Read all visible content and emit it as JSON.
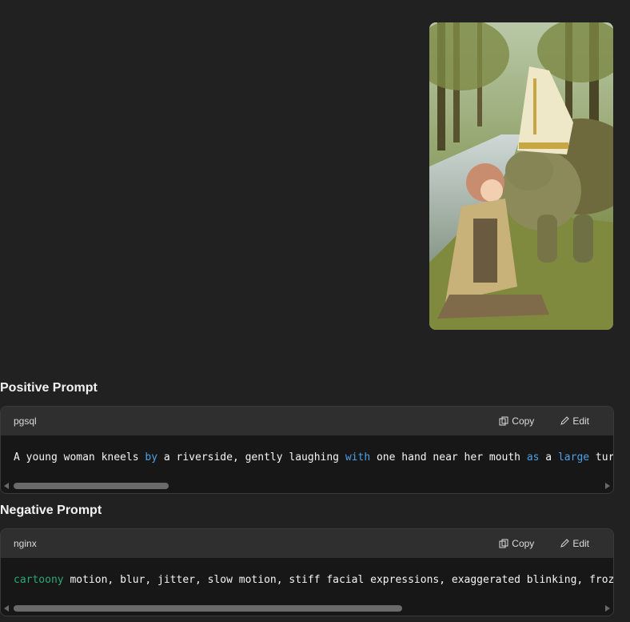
{
  "image": {
    "alt": ""
  },
  "positive": {
    "title": "Positive Prompt",
    "lang": "pgsql",
    "copy_label": "Copy",
    "edit_label": "Edit",
    "code_segments": [
      {
        "text": "A young woman kneels ",
        "kind": "plain"
      },
      {
        "text": "by",
        "kind": "kw"
      },
      {
        "text": " a riverside, gently laughing ",
        "kind": "plain"
      },
      {
        "text": "with",
        "kind": "kw"
      },
      {
        "text": " one hand near her mouth ",
        "kind": "plain"
      },
      {
        "text": "as",
        "kind": "kw"
      },
      {
        "text": " a ",
        "kind": "plain"
      },
      {
        "text": "large",
        "kind": "kw"
      },
      {
        "text": " turtl",
        "kind": "plain"
      }
    ]
  },
  "negative": {
    "title": "Negative Prompt",
    "lang": "nginx",
    "copy_label": "Copy",
    "edit_label": "Edit",
    "code_segments": [
      {
        "text": "cartoony",
        "kind": "kw-green"
      },
      {
        "text": " motion, blur, jitter, slow motion, stiff facial expressions, exaggerated blinking, frozen",
        "kind": "plain"
      }
    ]
  },
  "colors": {
    "bg": "#212121",
    "code_bg": "#171717",
    "header_bg": "#2f2f2f",
    "keyword_blue": "#4ea1e6",
    "keyword_green": "#2aa87a"
  }
}
